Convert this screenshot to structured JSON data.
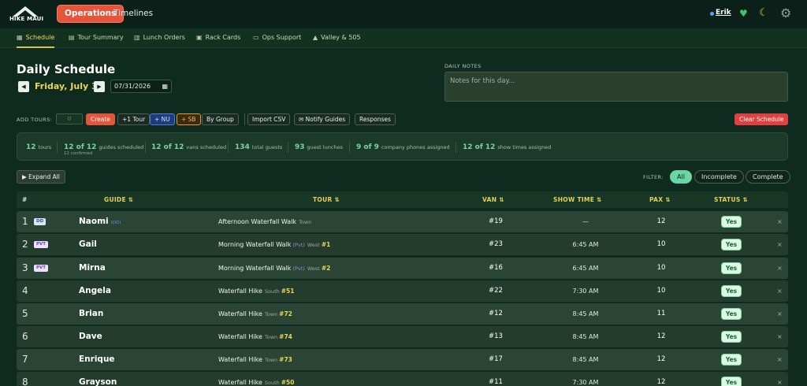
{
  "app": {
    "logo_text": "HIKE MAUI",
    "nav": {
      "operations": "Operations",
      "timelines": "Timelines"
    },
    "user": "Erik",
    "icons": {
      "heart": "heart-icon",
      "moon": "moon-icon",
      "gear": "gear-icon"
    }
  },
  "subtabs": [
    {
      "label": "Schedule",
      "icon": "calendar-icon",
      "active": true
    },
    {
      "label": "Tour Summary",
      "icon": "document-icon"
    },
    {
      "label": "Lunch Orders",
      "icon": "lunch-icon"
    },
    {
      "label": "Rack Cards",
      "icon": "rack-icon"
    },
    {
      "label": "Ops Support",
      "icon": "van-icon"
    },
    {
      "label": "Valley & 505",
      "icon": "mountain-icon"
    }
  ],
  "schedule": {
    "title": "Daily Schedule",
    "prev": "◀",
    "next": "▶",
    "date_label": "Friday, July 31",
    "date_value": "07/31/2026"
  },
  "notes": {
    "label": "DAILY NOTES",
    "placeholder": "Notes for this day..."
  },
  "toolbar": {
    "add_label": "ADD TOURS:",
    "add_value": "0",
    "create": "Create",
    "plus_tour": "+1 Tour",
    "plus_nu": "+ NU",
    "plus_sb": "+ SB",
    "by_group": "By Group",
    "import_csv": "Import CSV",
    "notify_guides": "Notify Guides",
    "responses": "Responses",
    "clear_schedule": "Clear Schedule"
  },
  "stats": {
    "tours": {
      "value": "12",
      "label": "tours"
    },
    "guides": {
      "value": "12 of 12",
      "label": "guides scheduled",
      "sub": "12 confirmed"
    },
    "vans": {
      "value": "12 of 12",
      "label": "vans scheduled"
    },
    "guests": {
      "value": "134",
      "label": "total guests"
    },
    "lunches": {
      "value": "93",
      "label": "guest lunches"
    },
    "phones": {
      "value": "9 of 9",
      "label": "company phones assigned"
    },
    "showtimes": {
      "value": "12 of 12",
      "label": "show times assigned"
    }
  },
  "controls": {
    "expand_all": "▶ Expand All",
    "filter_label": "FILTER:",
    "filters": [
      "All",
      "Incomplete",
      "Complete"
    ]
  },
  "table": {
    "headers": {
      "num": "#",
      "guide": "GUIDE ⇅",
      "tour": "TOUR ⇅",
      "van": "VAN ⇅",
      "show": "SHOW TIME ⇅",
      "pax": "PAX ⇅",
      "status": "STATUS ⇅"
    },
    "rows": [
      {
        "num": "1",
        "badge": "DD",
        "guide": "Naomi",
        "guide_tag": "(DD)",
        "tour": "Afternoon Waterfall Walk",
        "pvt": "",
        "area": "Town",
        "group": "",
        "van": "#19",
        "show": "—",
        "pax": "12",
        "status": "Yes"
      },
      {
        "num": "2",
        "badge": "PVT",
        "guide": "Gail",
        "guide_tag": "",
        "tour": "Morning Waterfall Walk",
        "pvt": "(Pvt)",
        "area": "West",
        "group": "#1",
        "van": "#23",
        "show": "6:45 AM",
        "pax": "10",
        "status": "Yes"
      },
      {
        "num": "3",
        "badge": "PVT",
        "guide": "Mirna",
        "guide_tag": "",
        "tour": "Morning Waterfall Walk",
        "pvt": "(Pvt)",
        "area": "West",
        "group": "#2",
        "van": "#16",
        "show": "6:45 AM",
        "pax": "10",
        "status": "Yes"
      },
      {
        "num": "4",
        "badge": "",
        "guide": "Angela",
        "guide_tag": "",
        "tour": "Waterfall Hike",
        "pvt": "",
        "area": "South",
        "group": "#51",
        "van": "#22",
        "show": "7:30 AM",
        "pax": "10",
        "status": "Yes"
      },
      {
        "num": "5",
        "badge": "",
        "guide": "Brian",
        "guide_tag": "",
        "tour": "Waterfall Hike",
        "pvt": "",
        "area": "Town",
        "group": "#72",
        "van": "#12",
        "show": "8:45 AM",
        "pax": "11",
        "status": "Yes"
      },
      {
        "num": "6",
        "badge": "",
        "guide": "Dave",
        "guide_tag": "",
        "tour": "Waterfall Hike",
        "pvt": "",
        "area": "Town",
        "group": "#74",
        "van": "#13",
        "show": "8:45 AM",
        "pax": "12",
        "status": "Yes"
      },
      {
        "num": "7",
        "badge": "",
        "guide": "Enrique",
        "guide_tag": "",
        "tour": "Waterfall Hike",
        "pvt": "",
        "area": "Town",
        "group": "#73",
        "van": "#17",
        "show": "8:45 AM",
        "pax": "12",
        "status": "Yes"
      },
      {
        "num": "8",
        "badge": "",
        "guide": "Grayson",
        "guide_tag": "",
        "tour": "Waterfall Hike",
        "pvt": "",
        "area": "South",
        "group": "#50",
        "van": "#11",
        "show": "7:30 AM",
        "pax": "12",
        "status": "Yes"
      }
    ],
    "remove_glyph": "×"
  }
}
